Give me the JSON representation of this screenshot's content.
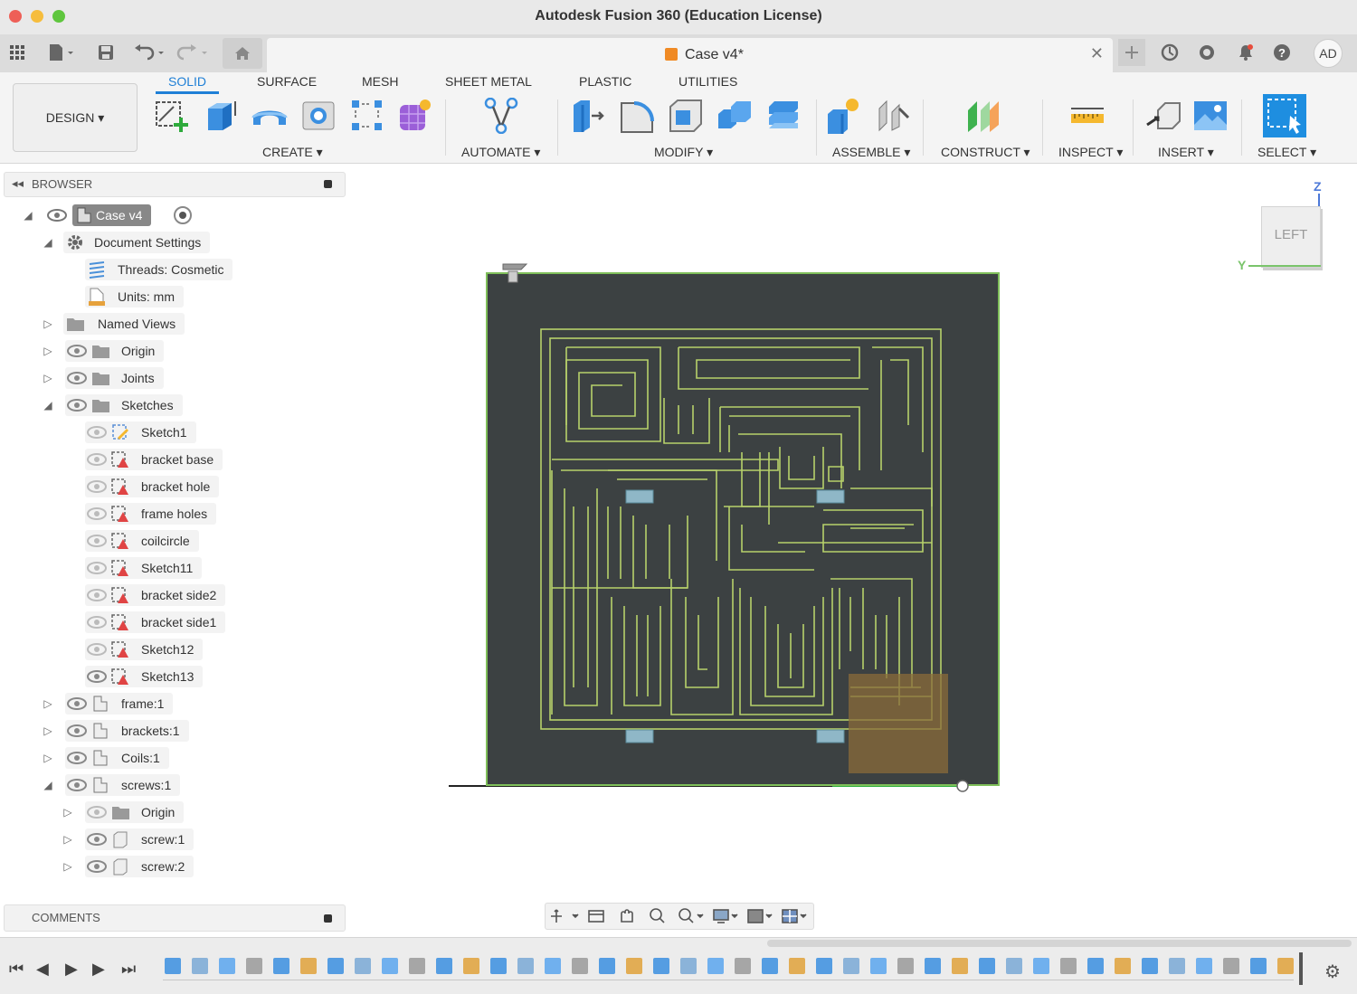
{
  "window": {
    "title": "Autodesk Fusion 360 (Education License)"
  },
  "app_bar": {
    "tab_label": "Case v4*",
    "avatar": "AD"
  },
  "ribbon": {
    "workspace_button": "DESIGN ▾",
    "tabs": [
      "SOLID",
      "SURFACE",
      "MESH",
      "SHEET METAL",
      "PLASTIC",
      "UTILITIES"
    ],
    "active_tab": "SOLID",
    "groups": [
      "CREATE ▾",
      "AUTOMATE ▾",
      "MODIFY ▾",
      "ASSEMBLE ▾",
      "CONSTRUCT ▾",
      "INSPECT ▾",
      "INSERT ▾",
      "SELECT ▾"
    ]
  },
  "browser": {
    "title": "BROWSER",
    "items": [
      {
        "label": "Case v4",
        "type": "root"
      },
      {
        "label": "Document Settings",
        "type": "settings"
      },
      {
        "label": "Threads: Cosmetic",
        "type": "threads"
      },
      {
        "label": "Units: mm",
        "type": "units"
      },
      {
        "label": "Named Views",
        "type": "folder"
      },
      {
        "label": "Origin",
        "type": "folder"
      },
      {
        "label": "Joints",
        "type": "folder"
      },
      {
        "label": "Sketches",
        "type": "folder"
      },
      {
        "label": "Sketch1",
        "type": "sketch"
      },
      {
        "label": "bracket base",
        "type": "sketch"
      },
      {
        "label": "bracket hole",
        "type": "sketch"
      },
      {
        "label": "frame holes",
        "type": "sketch"
      },
      {
        "label": "coilcircle",
        "type": "sketch"
      },
      {
        "label": "Sketch11",
        "type": "sketch"
      },
      {
        "label": "bracket side2",
        "type": "sketch"
      },
      {
        "label": "bracket side1",
        "type": "sketch"
      },
      {
        "label": "Sketch12",
        "type": "sketch"
      },
      {
        "label": "Sketch13",
        "type": "sketch"
      },
      {
        "label": "frame:1",
        "type": "component"
      },
      {
        "label": "brackets:1",
        "type": "component"
      },
      {
        "label": "Coils:1",
        "type": "component"
      },
      {
        "label": "screws:1",
        "type": "component"
      },
      {
        "label": "Origin",
        "type": "folder"
      },
      {
        "label": "screw:1",
        "type": "body"
      },
      {
        "label": "screw:2",
        "type": "body"
      }
    ]
  },
  "comments": {
    "title": "COMMENTS"
  },
  "viewcube": {
    "face": "LEFT",
    "axis_z": "Z",
    "axis_y": "Y"
  },
  "colors": {
    "accent": "#1e7fd6",
    "model_fill": "#3c4142",
    "maze_line": "#b7d16b",
    "highlight": "#8a6b3a"
  }
}
